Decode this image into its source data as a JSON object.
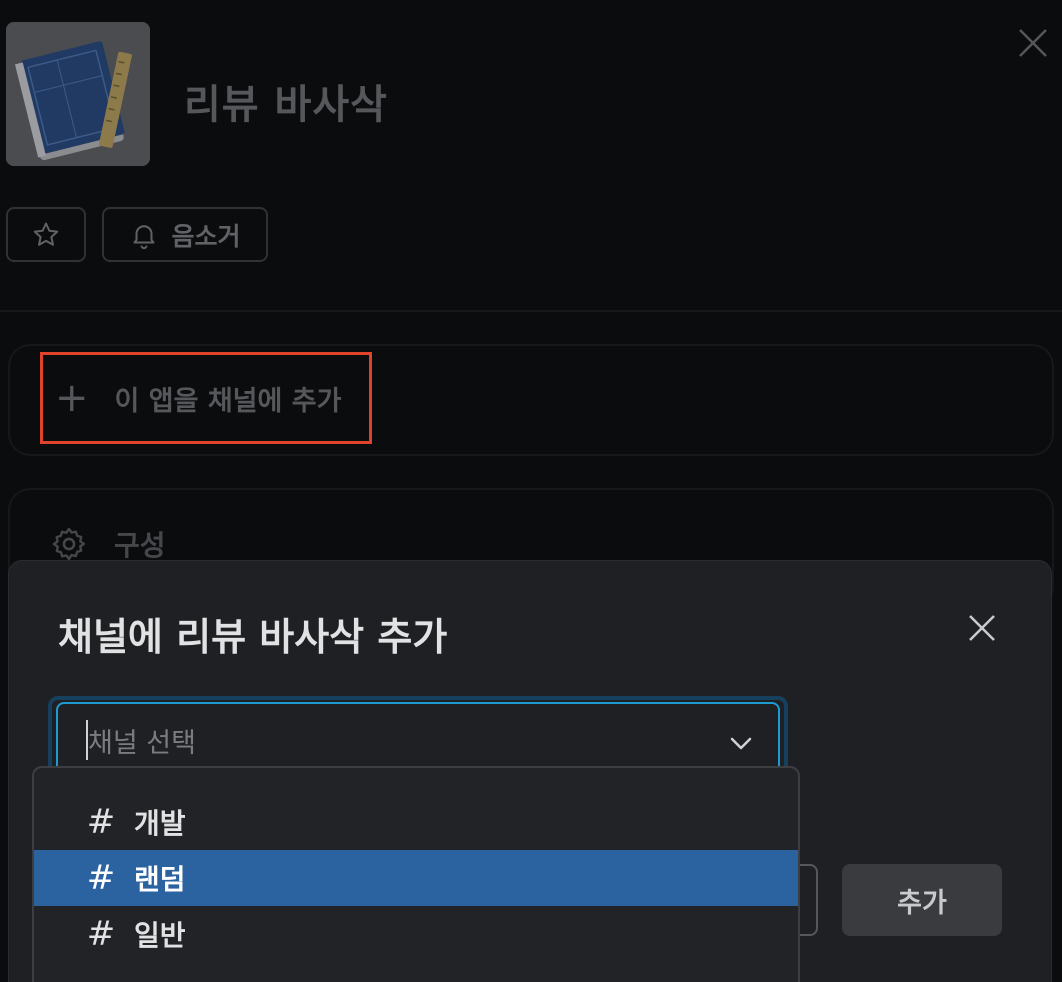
{
  "app": {
    "title": "리뷰 바사삭",
    "icon": "blueprint-notebook-icon",
    "mute_label": "음소거",
    "add_to_channel_label": "이 앱을 채널에 추가",
    "config_label": "구성"
  },
  "modal": {
    "title": "채널에 리뷰 바사삭 추가",
    "select": {
      "placeholder": "채널 선택",
      "value": ""
    },
    "options": [
      {
        "prefix": "#",
        "label": "개발",
        "selected": false
      },
      {
        "prefix": "#",
        "label": "랜덤",
        "selected": true
      },
      {
        "prefix": "#",
        "label": "일반",
        "selected": false
      }
    ],
    "add_button": "추가"
  },
  "colors": {
    "background": "#0b0c0e",
    "modal": "#1f2023",
    "focus_border": "#1d9bd1",
    "selected_option": "#2b62a0",
    "highlight_box": "#e0432c"
  }
}
